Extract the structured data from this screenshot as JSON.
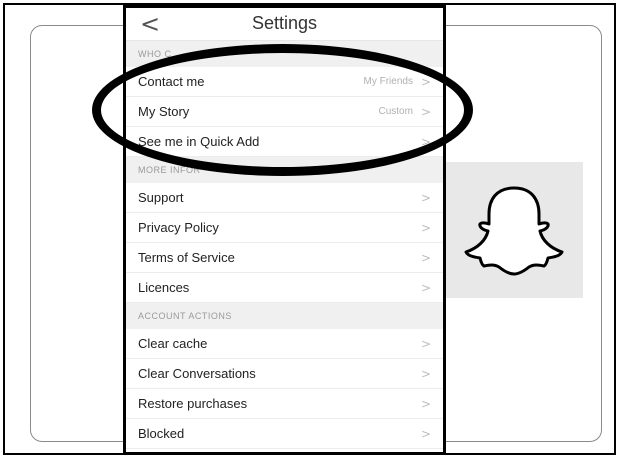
{
  "header": {
    "back_glyph": "<",
    "title": "Settings"
  },
  "sections": [
    {
      "heading": "WHO C",
      "items": [
        {
          "label": "Contact me",
          "value": "My Friends"
        },
        {
          "label": "My Story",
          "value": "Custom"
        },
        {
          "label": "See me in Quick Add",
          "value": ""
        }
      ]
    },
    {
      "heading": "MORE INFOR",
      "items": [
        {
          "label": "Support",
          "value": ""
        },
        {
          "label": "Privacy Policy",
          "value": ""
        },
        {
          "label": "Terms of Service",
          "value": ""
        },
        {
          "label": "Licences",
          "value": ""
        }
      ]
    },
    {
      "heading": "ACCOUNT ACTIONS",
      "items": [
        {
          "label": "Clear cache",
          "value": ""
        },
        {
          "label": "Clear Conversations",
          "value": ""
        },
        {
          "label": "Restore purchases",
          "value": ""
        },
        {
          "label": "Blocked",
          "value": ""
        }
      ]
    }
  ],
  "chevron_glyph": ">",
  "icons": {
    "ghost": "snapchat-ghost-icon",
    "back": "chevron-left-icon",
    "row": "chevron-right-icon"
  },
  "colors": {
    "ghost_bg": "#e8e8e8",
    "section_bg": "#f0f0f0",
    "highlight_ellipse": "#000000"
  }
}
